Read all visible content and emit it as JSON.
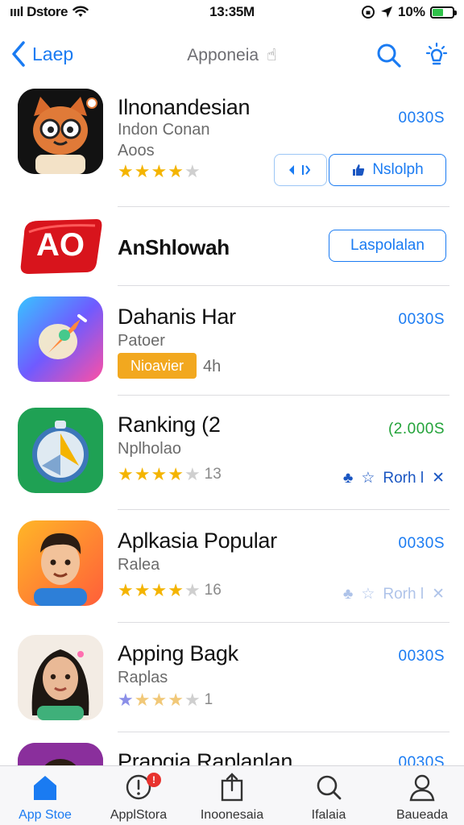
{
  "status_bar": {
    "carrier": "ıııl Dstore",
    "time": "13:35M",
    "battery": "10%",
    "battery_level": 0.55,
    "battery_color": "#2fc24a"
  },
  "nav": {
    "back_label": "Laep",
    "title": "Apponeia",
    "accent": "#1a7bf2"
  },
  "apps": [
    {
      "title": "Ilnonandesian",
      "subtitle": "Indon Conan",
      "subtitle2": "Aoos",
      "price": "0030S",
      "rating": 4,
      "buttons": [
        "Nslolph"
      ]
    },
    {
      "title": "AnShlowah",
      "icon_text": "AO",
      "button": "Laspolalan"
    },
    {
      "title": "Dahanis Har",
      "subtitle": "Patoer",
      "badge": "Nioavier",
      "duration": "4h",
      "price": "0030S"
    },
    {
      "title": "Ranking (2",
      "subtitle": "Nplholao",
      "price": "(2.000S",
      "rating": 4,
      "rating_count": "13",
      "action": "Rorh l",
      "price_color": "#23a33a"
    },
    {
      "title": "Aplkasia Popular",
      "subtitle": "Ralea",
      "price": "0030S",
      "rating": 4,
      "rating_count": "16",
      "action": "Rorh l"
    },
    {
      "title": "Apping Bagk",
      "subtitle": "Raplas",
      "price": "0030S",
      "rating": 4,
      "rating_count": "1"
    },
    {
      "title": "Prapgia Raplanlan",
      "price": "0030S"
    }
  ],
  "tabs": [
    {
      "label": "App Stoe",
      "icon": "house-icon",
      "active": true
    },
    {
      "label": "ApplStora",
      "icon": "notification-icon",
      "badge": "!"
    },
    {
      "label": "Inoonesaia",
      "icon": "share-icon"
    },
    {
      "label": "Ifalaia",
      "icon": "search-icon"
    },
    {
      "label": "Baueada",
      "icon": "person-icon"
    }
  ]
}
